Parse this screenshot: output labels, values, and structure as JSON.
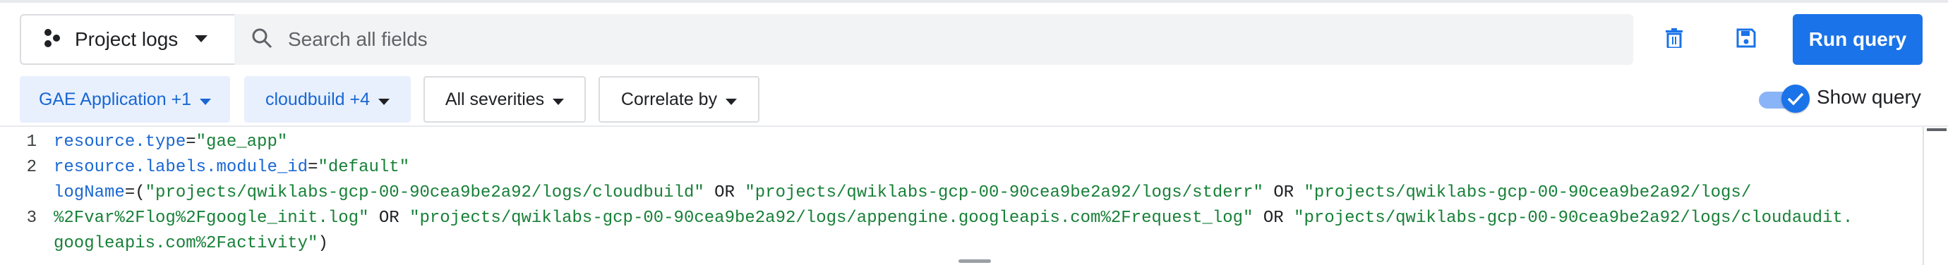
{
  "colors": {
    "accent": "#1a73e8",
    "chip_active_bg": "#e8f0fe",
    "chip_active_text": "#1967d2",
    "search_bg": "#f1f3f4",
    "string": "#188038",
    "keyword": "#1967d2"
  },
  "toolbar": {
    "scope_label": "Project logs",
    "scope_icon": "project-logs-icon",
    "search": {
      "placeholder": "Search all fields",
      "value": ""
    },
    "delete_icon": "trash-icon",
    "save_icon": "save-icon",
    "run_label": "Run query"
  },
  "filters": {
    "resource_label": "GAE Application +1",
    "log_name_label": "cloudbuild +4",
    "severity_label": "All severities",
    "correlate_label": "Correlate by"
  },
  "show_query": {
    "label": "Show query",
    "checked": true
  },
  "editor": {
    "line_numbers": [
      "1",
      "2",
      "",
      "3",
      "",
      ""
    ],
    "lines": [
      [
        {
          "t": "k",
          "v": "resource.type"
        },
        {
          "t": "o",
          "v": "="
        },
        {
          "t": "s",
          "v": "\"gae_app\""
        }
      ],
      [
        {
          "t": "k",
          "v": "resource.labels.module_id"
        },
        {
          "t": "o",
          "v": "="
        },
        {
          "t": "s",
          "v": "\"default\""
        }
      ],
      [
        {
          "t": "k",
          "v": "logName"
        },
        {
          "t": "o",
          "v": "=("
        },
        {
          "t": "s",
          "v": "\"projects/qwiklabs-gcp-00-90cea9be2a92/logs/cloudbuild\""
        },
        {
          "t": "o",
          "v": " OR "
        },
        {
          "t": "s",
          "v": "\"projects/qwiklabs-gcp-00-90cea9be2a92/logs/stderr\""
        },
        {
          "t": "o",
          "v": " OR "
        },
        {
          "t": "s",
          "v": "\"projects/qwiklabs-gcp-00-90cea9be2a92/logs/"
        }
      ],
      [
        {
          "t": "s",
          "v": "%2Fvar%2Flog%2Fgoogle_init.log\""
        },
        {
          "t": "o",
          "v": " OR "
        },
        {
          "t": "s",
          "v": "\"projects/qwiklabs-gcp-00-90cea9be2a92/logs/appengine.googleapis.com%2Frequest_log\""
        },
        {
          "t": "o",
          "v": " OR "
        },
        {
          "t": "s",
          "v": "\"projects/qwiklabs-gcp-00-90cea9be2a92/logs/cloudaudit."
        }
      ],
      [
        {
          "t": "s",
          "v": "googleapis.com%2Factivity\""
        },
        {
          "t": "o",
          "v": ")"
        }
      ]
    ]
  }
}
